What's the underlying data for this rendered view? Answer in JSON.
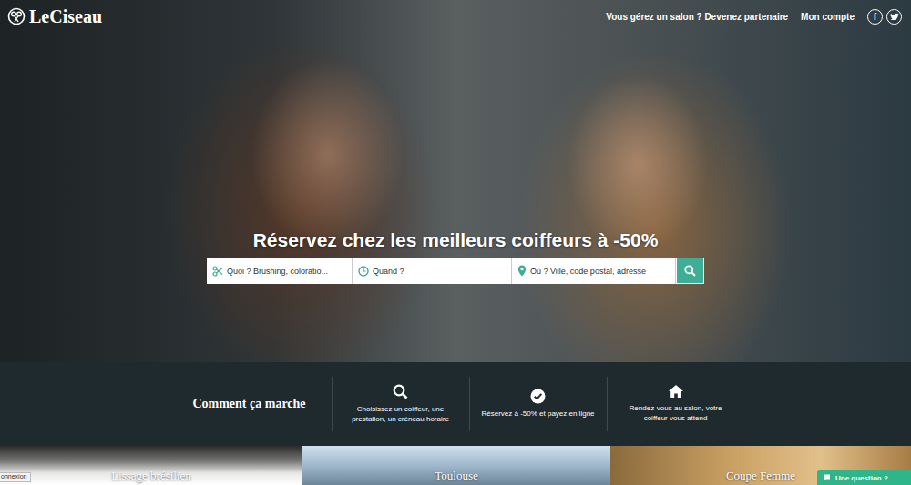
{
  "header": {
    "logo": "LeCiseau",
    "links": [
      "Vous gérez un salon ? Devenez partenaire",
      "Mon compte"
    ],
    "social": [
      "f"
    ]
  },
  "hero": {
    "headline": "Réservez chez les meilleurs coiffeurs à -50%",
    "fields": [
      {
        "placeholder": "Quoi ? Brushing, coloratio..."
      },
      {
        "placeholder": "Quand ?"
      },
      {
        "placeholder": "Où ? Ville, code postal, adresse"
      }
    ]
  },
  "how_it_works": {
    "title": "Comment ça marche",
    "steps": [
      "Choisissez un coiffeur, une prestation, un créneau horaire",
      "Réservez à -50% et payez en ligne",
      "Rendez-vous au salon, votre coiffeur vous attend"
    ]
  },
  "categories": [
    "Lissage brésilien",
    "Toulouse",
    "Coupe Femme"
  ],
  "chat": {
    "label": "Une question ?"
  },
  "login_tab": {
    "label": "onnexion"
  }
}
